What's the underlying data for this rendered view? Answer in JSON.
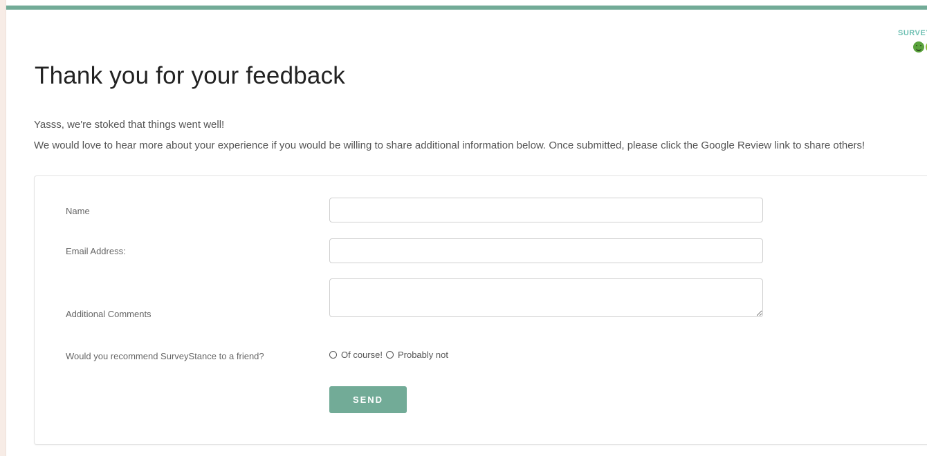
{
  "colors": {
    "accent": "#72ab97",
    "logo_text": "#6ec0b3",
    "left_rule": "#f7ece6"
  },
  "logo": {
    "text": "SURVEY",
    "icon_names": [
      "happy-face-icon",
      "smile-face-icon",
      "neutral-face-icon"
    ]
  },
  "page": {
    "title": "Thank you for your feedback",
    "subtitle": "Yasss, we're stoked that things went well!",
    "intro": "We would love to hear more about your experience if you would be willing to share additional information below. Once submitted, please click the Google Review link to share others!"
  },
  "form": {
    "name_label": "Name",
    "name_value": "",
    "email_label": "Email Address:",
    "email_value": "",
    "comments_label": "Additional Comments",
    "comments_value": "",
    "recommend_label": "Would you recommend SurveyStance to a friend?",
    "recommend_options": [
      "Of course!",
      "Probably not"
    ],
    "recommend_selected": null,
    "send_label": "SEND"
  }
}
